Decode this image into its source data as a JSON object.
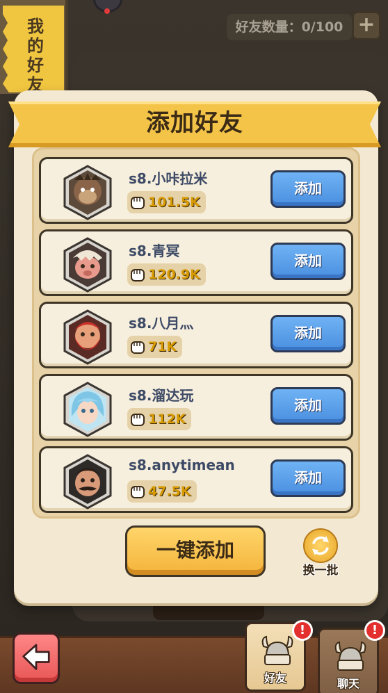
{
  "background": {
    "side_tab_text": "我的好友",
    "friend_count_label": "好友数量：0/100",
    "add_icon": "plus-icon"
  },
  "dialog": {
    "title": "添加好友",
    "candidates": [
      {
        "name": "s8.小咔拉米",
        "power": "101.5K",
        "add_label": "添加",
        "avatar": "monkey-warrior-avatar"
      },
      {
        "name": "s8.青冥",
        "power": "120.9K",
        "add_label": "添加",
        "avatar": "pig-skull-avatar"
      },
      {
        "name": "s8.八月灬",
        "power": "71K",
        "add_label": "添加",
        "avatar": "red-bearded-warrior-avatar"
      },
      {
        "name": "s8.溜达玩",
        "power": "112K",
        "add_label": "添加",
        "avatar": "blue-hair-elf-avatar"
      },
      {
        "name": "s8.anytimean",
        "power": "47.5K",
        "add_label": "添加",
        "avatar": "mustache-man-avatar"
      }
    ],
    "add_all_label": "一键添加",
    "refresh_label": "换一批"
  },
  "bottom_bar": {
    "back_icon": "back-arrow-icon",
    "friends_label": "好友",
    "chat_label": "聊天",
    "friends_badge": "!",
    "chat_badge": "!"
  },
  "colors": {
    "title_ribbon": "#f3c448",
    "add_button": "#4a8fe0",
    "add_all_button": "#f3b33a",
    "power_text": "#d79a00",
    "badge": "#e3302f"
  }
}
